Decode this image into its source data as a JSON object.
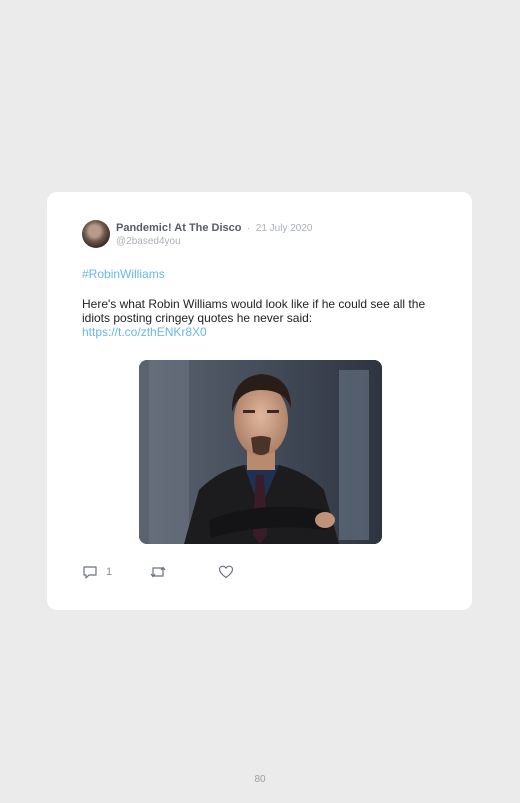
{
  "tweet": {
    "author_name": "Pandemic! At The Disco",
    "separator": "·",
    "date": "21 July 2020",
    "handle": "@2based4you",
    "hashtag": "#RobinWilliams",
    "text": "Here's what Robin Williams would look like if he could see all the idiots posting cringey quotes he never said:",
    "link": "https://t.co/zthENKr8X0",
    "reply_count": "1"
  },
  "icons": {
    "reply": "reply-icon",
    "retweet": "retweet-icon",
    "like": "heart-icon"
  },
  "page": {
    "number": "80"
  }
}
